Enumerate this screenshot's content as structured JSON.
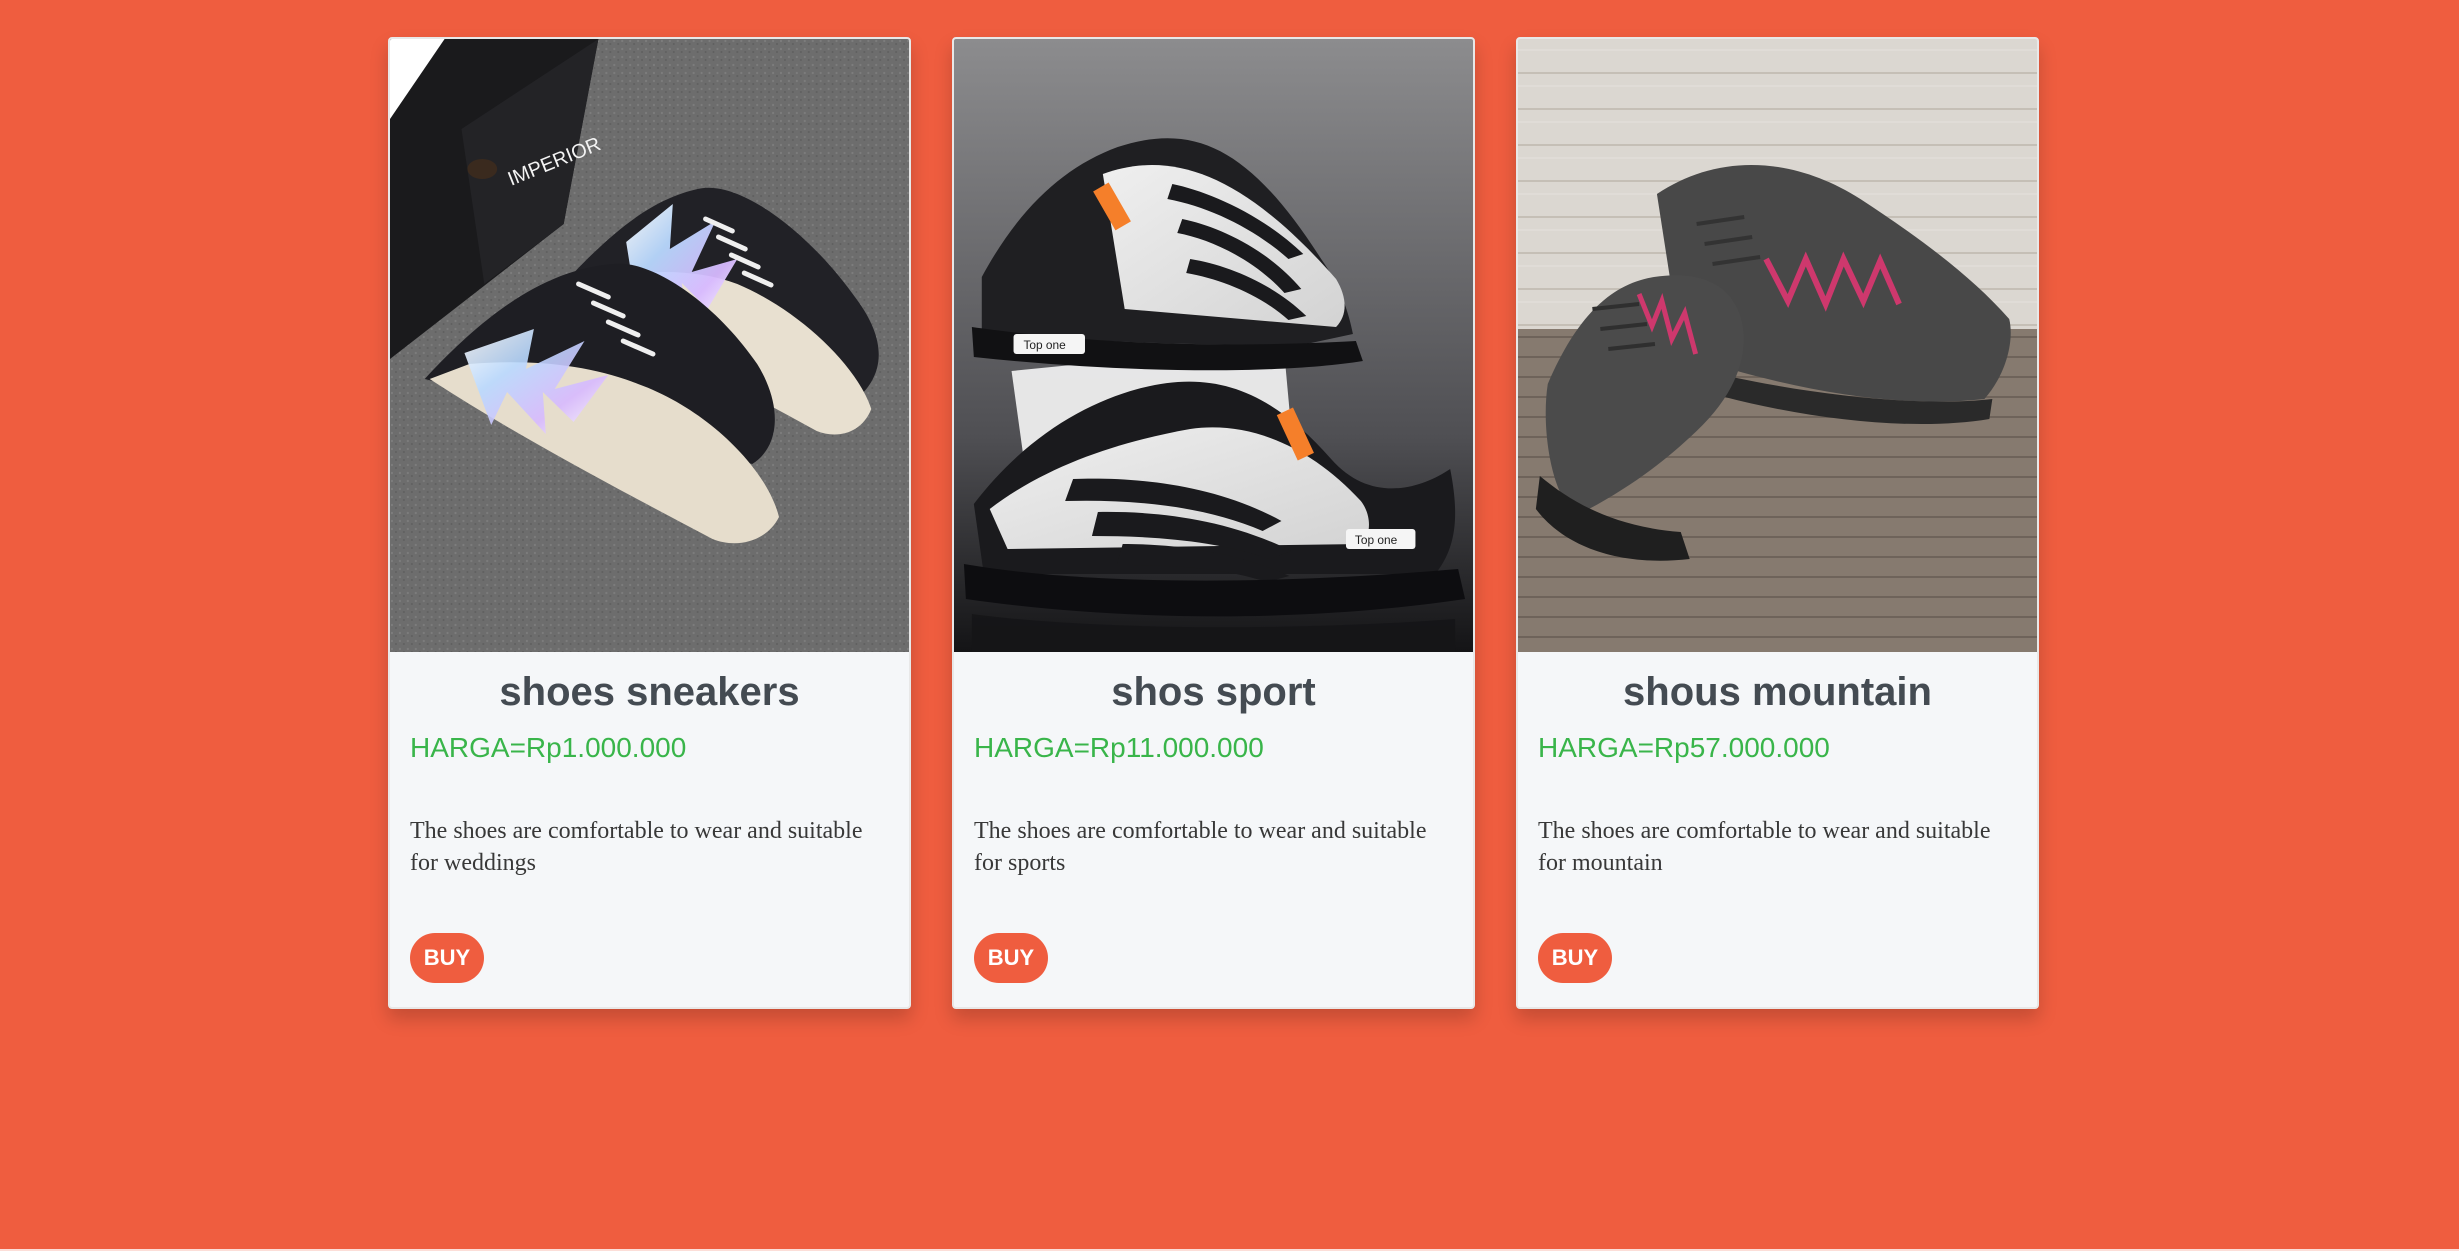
{
  "products": [
    {
      "name": "shoes sneakers",
      "price": "HARGA=Rp1.000.000",
      "description": "The shoes are comfortable to wear and suitable for weddings",
      "button": "BUY",
      "box_text": "IMPERIOR"
    },
    {
      "name": "shos sport",
      "price": "HARGA=Rp11.000.000",
      "description": "The shoes are comfortable to wear and suitable for sports",
      "button": "BUY",
      "brand_text": "Top one"
    },
    {
      "name": "shous mountain",
      "price": "HARGA=Rp57.000.000",
      "description": "The shoes are comfortable to wear and suitable for mountain",
      "button": "BUY"
    }
  ],
  "colors": {
    "background": "#ef5d3f",
    "card": "#f5f7f9",
    "title": "#444b52",
    "price": "#39b54a",
    "button": "#ef5d3f"
  }
}
